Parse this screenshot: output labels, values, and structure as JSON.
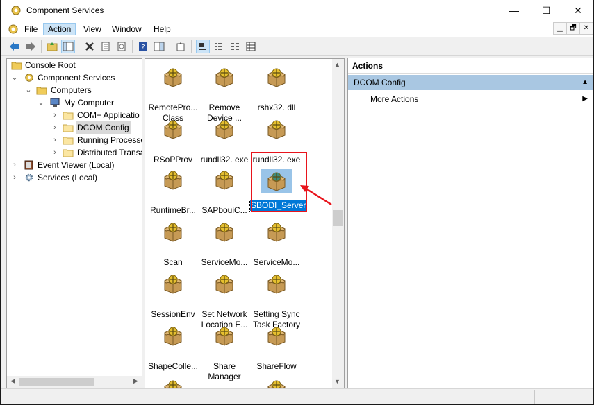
{
  "window": {
    "title": "Component Services",
    "controls": {
      "minimize": "—",
      "maximize": "☐",
      "close": "✕"
    }
  },
  "menu": {
    "items": [
      "File",
      "Action",
      "View",
      "Window",
      "Help"
    ],
    "active": "Action",
    "mdi_controls": [
      "▁",
      "🗗",
      "✕"
    ]
  },
  "toolbar": {
    "icons": [
      "back-arrow-icon",
      "forward-arrow-icon",
      "up-folder-icon",
      "show-hide-tree-icon",
      "delete-icon",
      "properties-icon",
      "refresh-icon",
      "help-icon",
      "show-hide-action-pane-icon",
      "export-list-icon",
      "large-icons-view-icon",
      "small-icons-view-icon",
      "list-view-icon",
      "detail-view-icon"
    ]
  },
  "tree": {
    "items": [
      {
        "label": "Console Root",
        "icon": "folder-icon",
        "expander": ""
      },
      {
        "label": "Component Services",
        "icon": "component-services-icon",
        "expander": "⌄"
      },
      {
        "label": "Computers",
        "icon": "folder-icon",
        "expander": "⌄"
      },
      {
        "label": "My Computer",
        "icon": "computer-icon",
        "expander": "⌄"
      },
      {
        "label": "COM+ Applicatio",
        "icon": "folder-icon",
        "expander": "›"
      },
      {
        "label": "DCOM Config",
        "icon": "folder-icon",
        "expander": "›",
        "selected": true
      },
      {
        "label": "Running Processe",
        "icon": "folder-icon",
        "expander": "›"
      },
      {
        "label": "Distributed Transa",
        "icon": "folder-icon",
        "expander": "›"
      },
      {
        "label": "Event Viewer (Local)",
        "icon": "event-viewer-icon",
        "expander": "›"
      },
      {
        "label": "Services (Local)",
        "icon": "services-gear-icon",
        "expander": "›"
      }
    ]
  },
  "list": {
    "items": [
      {
        "line1": "RemotePro...",
        "line2": "Class"
      },
      {
        "line1": "Remove",
        "line2": "Device ..."
      },
      {
        "line1": "rshx32. dll",
        "line2": ""
      },
      {
        "line1": "RSoPProv",
        "line2": ""
      },
      {
        "line1": "rundll32. exe",
        "line2": ""
      },
      {
        "line1": "rundll32. exe",
        "line2": ""
      },
      {
        "line1": "RuntimeBr...",
        "line2": ""
      },
      {
        "line1": "SAPbouiC...",
        "line2": ""
      },
      {
        "line1": "SBODI_Server",
        "line2": "",
        "selected": true
      },
      {
        "line1": "Scan",
        "line2": ""
      },
      {
        "line1": "ServiceMo...",
        "line2": ""
      },
      {
        "line1": "ServiceMo...",
        "line2": ""
      },
      {
        "line1": "SessionEnv",
        "line2": ""
      },
      {
        "line1": "Set Network",
        "line2": "Location E..."
      },
      {
        "line1": "Setting Sync",
        "line2": "Task Factory"
      },
      {
        "line1": "ShapeColle...",
        "line2": ""
      },
      {
        "line1": "Share",
        "line2": "Manager"
      },
      {
        "line1": "ShareFlow",
        "line2": ""
      }
    ]
  },
  "actions": {
    "header": "Actions",
    "section": "DCOM Config",
    "section_toggle": "▲",
    "items": [
      {
        "label": "More Actions",
        "arrow": "▶"
      }
    ]
  },
  "annotation": {
    "highlight_color": "#e8141c"
  },
  "colors": {
    "selection": "#0078d7",
    "section_bg": "#a9c7e2",
    "menu_active": "#cce4f7"
  }
}
